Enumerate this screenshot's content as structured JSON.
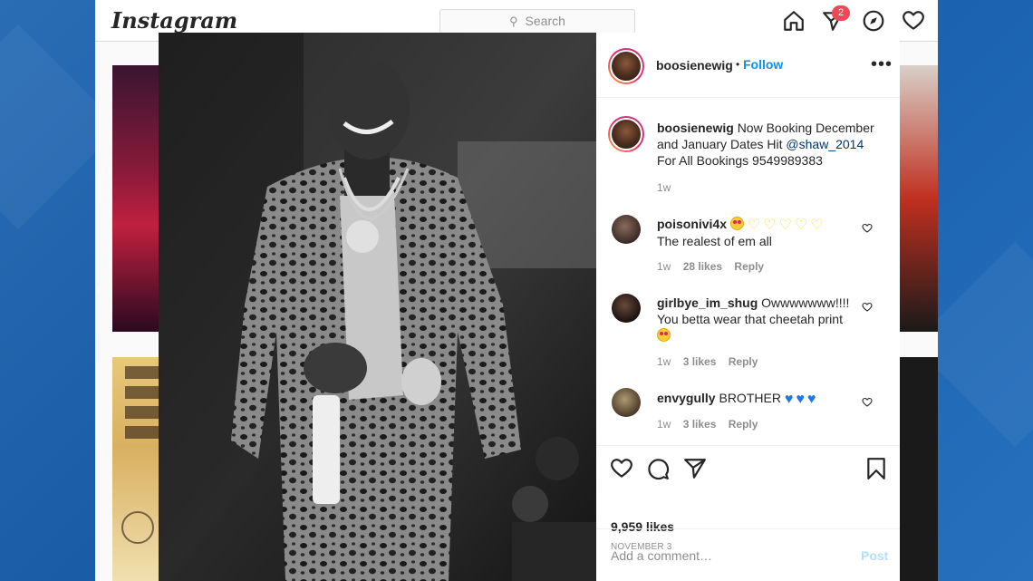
{
  "header": {
    "logo": "Instagram",
    "search_placeholder": "Search",
    "notification_count": "2"
  },
  "post": {
    "author": "boosienewig",
    "follow_label": "Follow",
    "bullet": "•",
    "caption": "Now Booking December and January Dates Hit",
    "caption_mention": "@shaw_2014",
    "caption_tail": "For All Bookings 9549989383",
    "caption_age": "1w",
    "likes": "9,959 likes",
    "date": "NOVEMBER 3",
    "comment_placeholder": "Add a comment…",
    "post_label": "Post"
  },
  "comments": [
    {
      "user": "poisonivi4x",
      "text": "The realest of em all",
      "age": "1w",
      "likes": "28 likes",
      "reply": "Reply"
    },
    {
      "user": "girlbye_im_shug",
      "text_inline": "Owwwwwww!!!!",
      "text": "You betta wear that cheetah print",
      "age": "1w",
      "likes": "3 likes",
      "reply": "Reply"
    },
    {
      "user": "envygully",
      "text_inline": "BROTHER",
      "age": "1w",
      "likes": "3 likes",
      "reply": "Reply"
    }
  ],
  "colors": {
    "link_blue": "#0095f6",
    "post_disabled": "#b2dffc",
    "badge_red": "#ed4956"
  }
}
